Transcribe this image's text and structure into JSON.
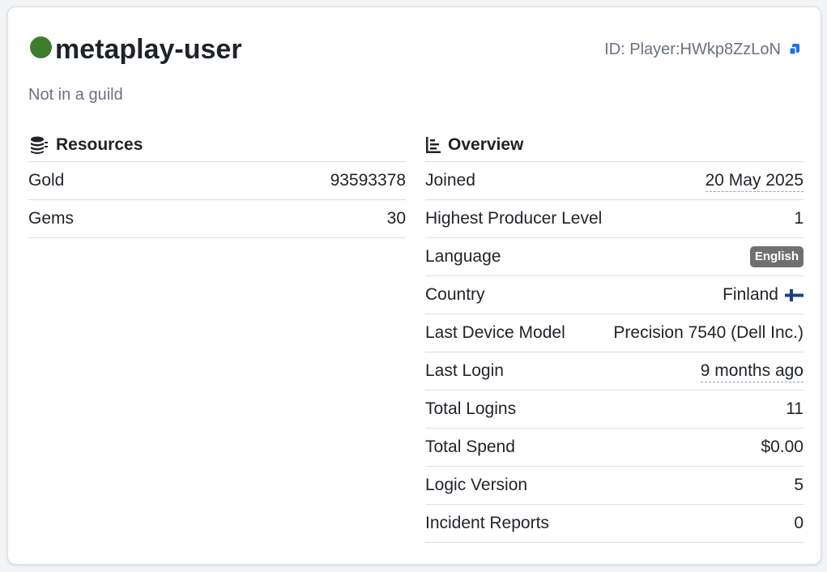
{
  "player": {
    "name": "metaplay-user",
    "status_color": "#3e7d2d",
    "id_text": "ID: Player:HWkp8ZzLoN",
    "guild_text": "Not in a guild"
  },
  "resources": {
    "title": "Resources",
    "rows": [
      {
        "label": "Gold",
        "value": "93593378"
      },
      {
        "label": "Gems",
        "value": "30"
      }
    ]
  },
  "overview": {
    "title": "Overview",
    "rows": [
      {
        "label": "Joined",
        "value": "20 May 2025"
      },
      {
        "label": "Highest Producer Level",
        "value": "1"
      },
      {
        "label": "Language",
        "value": "English"
      },
      {
        "label": "Country",
        "value": "Finland",
        "flag": "finland-flag-icon"
      },
      {
        "label": "Last Device Model",
        "value": "Precision 7540 (Dell Inc.)"
      },
      {
        "label": "Last Login",
        "value": "9 months ago"
      },
      {
        "label": "Total Logins",
        "value": "11"
      },
      {
        "label": "Total Spend",
        "value": "$0.00"
      },
      {
        "label": "Logic Version",
        "value": "5"
      },
      {
        "label": "Incident Reports",
        "value": "0"
      }
    ]
  },
  "icons": {
    "copy": "copy-icon",
    "resources": "coins-icon",
    "overview": "chart-bar-icon"
  },
  "colors": {
    "link": "#1a73e8",
    "badge": "#707070"
  }
}
